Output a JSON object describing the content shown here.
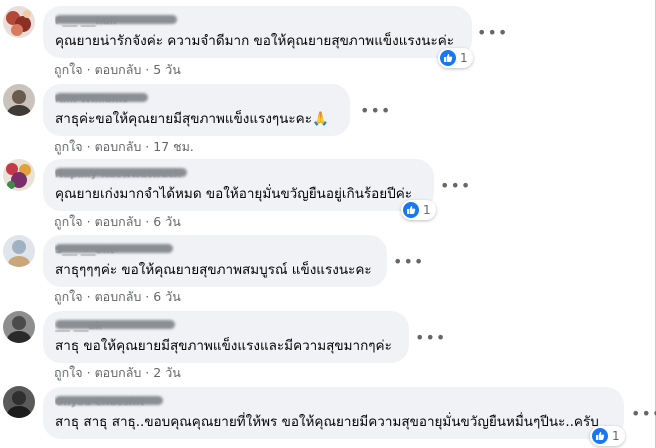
{
  "comments": [
    {
      "author": "P___ ___hall",
      "text": "คุณยายน่ารักจังค่ะ ความจำดีมาก ขอให้คุณยายสุขภาพแข็งแรงนะค่ะ",
      "like_label": "ถูกใจ",
      "reply_label": "ตอบกลับ",
      "time": "5 วัน",
      "reactions": "1",
      "more_label": "•••",
      "avatar_color": "#b24a3a"
    },
    {
      "author": "Kim Williams",
      "text": "สาธุค่ะขอให้คุณยายมีสุขภาพแข็งแรงๆนะคะ🙏",
      "like_label": "ถูกใจ",
      "reply_label": "ตอบกลับ",
      "time": "17 ชม.",
      "more_label": "•••",
      "avatar_color": "#6a5b4e"
    },
    {
      "author": "Napaky Kaewwatwach",
      "text": "คุณยายเก่งมากจำได้หมด ขอให้อายุมั่นขวัญยืนอยู่เกินร้อยปีค่ะ",
      "like_label": "ถูกใจ",
      "reply_label": "ตอบกลับ",
      "time": "6 วัน",
      "reactions": "1",
      "more_label": "•••",
      "avatar_color": "#c2394a"
    },
    {
      "author": "S___ ___ont",
      "text": "สาธุๆๆๆค่ะ ขอให้คุณยายสุขภาพสมบูรณ์ แข็งแรงนะคะ",
      "like_label": "ถูกใจ",
      "reply_label": "ตอบกลับ",
      "time": "6 วัน",
      "more_label": "•••",
      "avatar_color": "#9fb2c4"
    },
    {
      "author": "___ ___ak",
      "text": "สาธุ ขอให้คุณยายมีสุขภาพแข็งแรงและมีความสุขมากๆค่ะ",
      "like_label": "ถูกใจ",
      "reply_label": "ตอบกลับ",
      "time": "2 วัน",
      "more_label": "•••",
      "avatar_color": "#4b4b4b"
    },
    {
      "author": "Onyou Chueshit",
      "text": "สาธุ สาธุ สาธุ..ขอบคุณคุณยายที่ให้พร ขอให้คุณยายมีความสุขอายุมั่นขวัญยืนหมื่นๆปีนะ..ครับ",
      "reactions": "1",
      "more_label": "•••",
      "avatar_color": "#2f2f2f"
    }
  ],
  "colors": {
    "bubble": "#f0f2f5",
    "meta": "#65676b",
    "like_blue": "#1877f2"
  }
}
